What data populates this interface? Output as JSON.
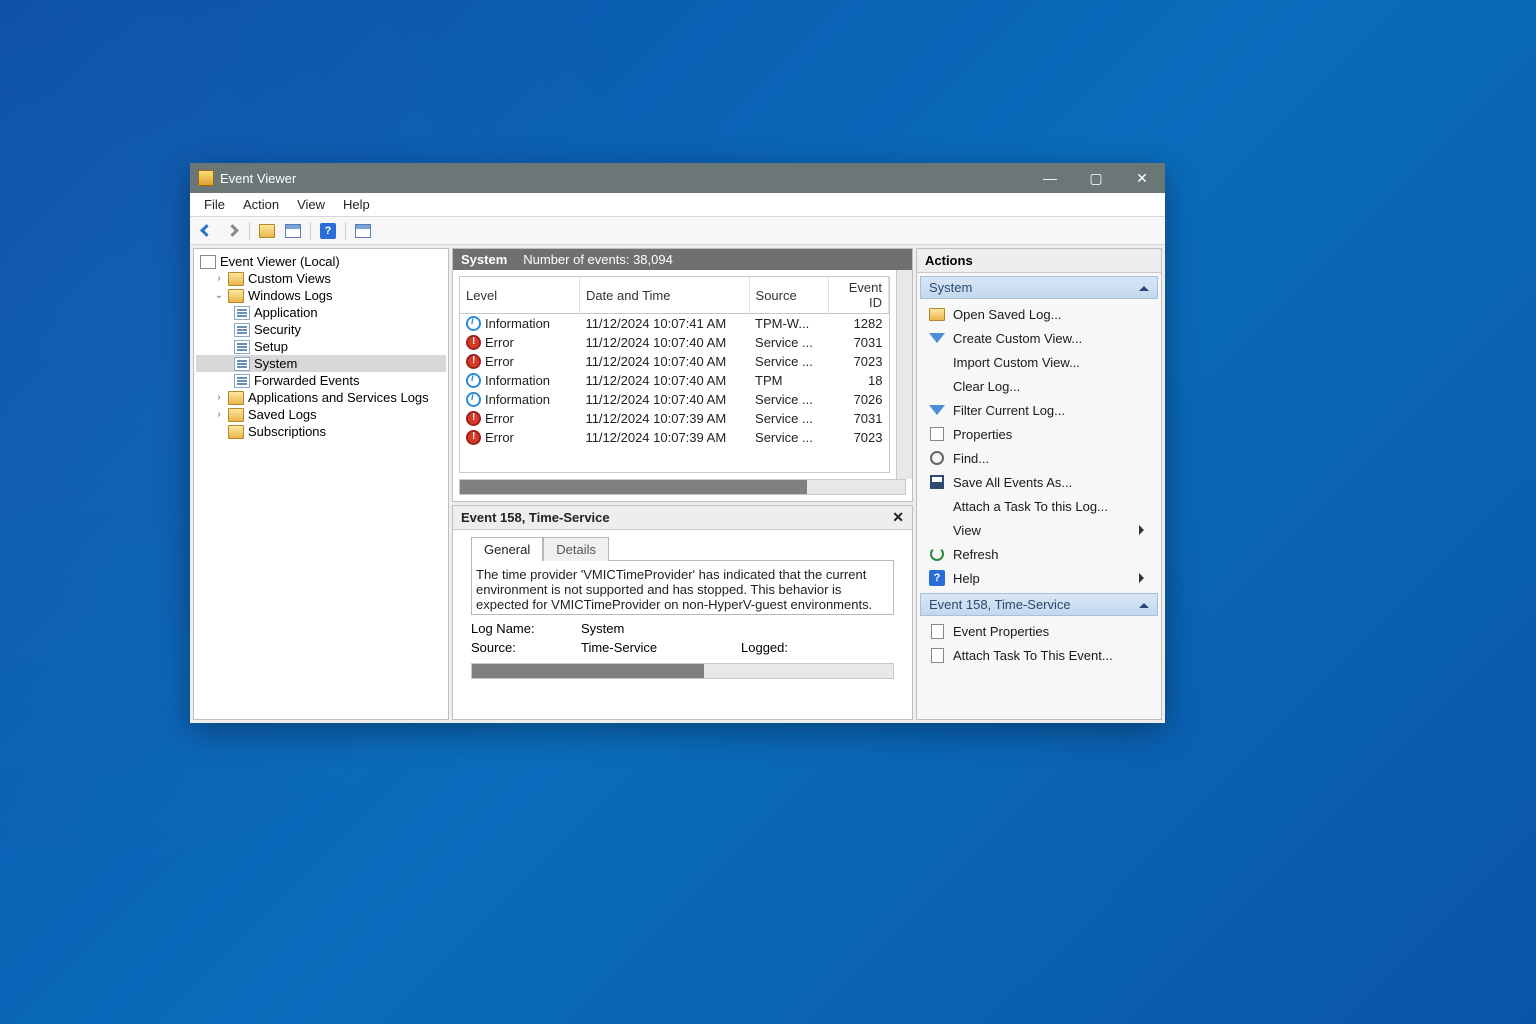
{
  "titlebar": {
    "title": "Event Viewer"
  },
  "menu": {
    "file": "File",
    "action": "Action",
    "view": "View",
    "help": "Help"
  },
  "tree": {
    "root": "Event Viewer (Local)",
    "custom": "Custom Views",
    "winlogs": "Windows Logs",
    "application": "Application",
    "security": "Security",
    "setup": "Setup",
    "system": "System",
    "forwarded": "Forwarded Events",
    "appsvc": "Applications and Services Logs",
    "saved": "Saved Logs",
    "subs": "Subscriptions"
  },
  "events_header": {
    "title": "System",
    "count_label": "Number of events: 38,094"
  },
  "columns": {
    "level": "Level",
    "datetime": "Date and Time",
    "source": "Source",
    "eventid": "Event ID"
  },
  "events": [
    {
      "level": "Information",
      "lvl": "info",
      "dt": "11/12/2024 10:07:41 AM",
      "src": "TPM-W...",
      "id": "1282"
    },
    {
      "level": "Error",
      "lvl": "error",
      "dt": "11/12/2024 10:07:40 AM",
      "src": "Service ...",
      "id": "7031"
    },
    {
      "level": "Error",
      "lvl": "error",
      "dt": "11/12/2024 10:07:40 AM",
      "src": "Service ...",
      "id": "7023"
    },
    {
      "level": "Information",
      "lvl": "info",
      "dt": "11/12/2024 10:07:40 AM",
      "src": "TPM",
      "id": "18"
    },
    {
      "level": "Information",
      "lvl": "info",
      "dt": "11/12/2024 10:07:40 AM",
      "src": "Service ...",
      "id": "7026"
    },
    {
      "level": "Error",
      "lvl": "error",
      "dt": "11/12/2024 10:07:39 AM",
      "src": "Service ...",
      "id": "7031"
    },
    {
      "level": "Error",
      "lvl": "error",
      "dt": "11/12/2024 10:07:39 AM",
      "src": "Service ...",
      "id": "7023"
    }
  ],
  "detail": {
    "header": "Event 158, Time-Service",
    "tab_general": "General",
    "tab_details": "Details",
    "description": "The time provider 'VMICTimeProvider' has indicated that the current environment is not supported and has stopped. This behavior is expected for VMICTimeProvider on non-HyperV-guest environments. This m",
    "logname_label": "Log Name:",
    "logname_value": "System",
    "source_label": "Source:",
    "source_value": "Time-Service",
    "logged_label": "Logged:"
  },
  "actions": {
    "title": "Actions",
    "section1": "System",
    "open": "Open Saved Log...",
    "create": "Create Custom View...",
    "import": "Import Custom View...",
    "clear": "Clear Log...",
    "filter": "Filter Current Log...",
    "props": "Properties",
    "find": "Find...",
    "saveall": "Save All Events As...",
    "attach": "Attach a Task To this Log...",
    "view": "View",
    "refresh": "Refresh",
    "help": "Help",
    "section2": "Event 158, Time-Service",
    "evprops": "Event Properties",
    "evattach": "Attach Task To This Event..."
  }
}
